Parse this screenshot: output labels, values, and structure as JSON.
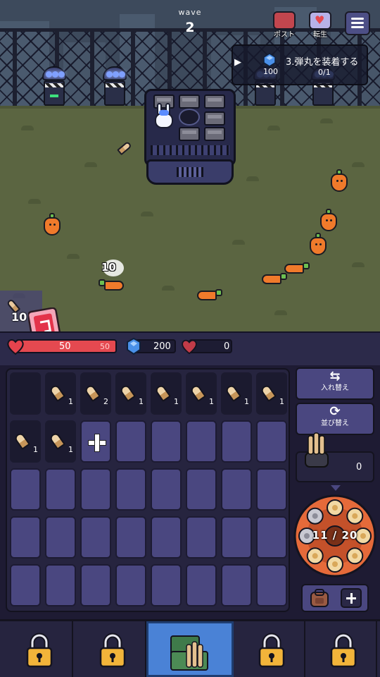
{
  "wave": {
    "label": "wave",
    "number": "2"
  },
  "top_buttons": [
    {
      "label": "ポスト",
      "icon": "mailbox-icon"
    },
    {
      "label": "転生",
      "icon": "rebirth-heart-icon"
    }
  ],
  "menu": {
    "icon": "hamburger-menu-icon"
  },
  "quest": {
    "text": "3.弾丸を装着する",
    "reward": "100",
    "progress": "0/1"
  },
  "battle": {
    "damage_popup": "10",
    "ammo_counter": "10"
  },
  "status": {
    "hp_current": "50",
    "hp_max": "50",
    "gems": "200",
    "bonus_hearts": "0",
    "colors": {
      "hp": "#e54950",
      "gem": "#4a90e8"
    }
  },
  "inventory": {
    "rows": [
      [
        {
          "type": "empty-dark"
        },
        {
          "type": "bullet",
          "count": "1"
        },
        {
          "type": "bullet",
          "count": "2"
        },
        {
          "type": "bullet",
          "count": "1"
        },
        {
          "type": "bullet",
          "count": "1"
        },
        {
          "type": "bullet",
          "count": "1"
        },
        {
          "type": "bullet",
          "count": "1"
        },
        {
          "type": "bullet",
          "count": "1"
        }
      ],
      [
        {
          "type": "bullet",
          "count": "1"
        },
        {
          "type": "bullet",
          "count": "1"
        },
        {
          "type": "add"
        },
        {
          "type": "empty"
        },
        {
          "type": "empty"
        },
        {
          "type": "empty"
        },
        {
          "type": "empty"
        },
        {
          "type": "empty"
        }
      ],
      [
        {
          "type": "empty"
        },
        {
          "type": "empty"
        },
        {
          "type": "empty"
        },
        {
          "type": "empty"
        },
        {
          "type": "empty"
        },
        {
          "type": "empty"
        },
        {
          "type": "empty"
        },
        {
          "type": "empty"
        }
      ],
      [
        {
          "type": "empty"
        },
        {
          "type": "empty"
        },
        {
          "type": "empty"
        },
        {
          "type": "empty"
        },
        {
          "type": "empty"
        },
        {
          "type": "empty"
        },
        {
          "type": "empty"
        },
        {
          "type": "empty"
        }
      ],
      [
        {
          "type": "empty"
        },
        {
          "type": "empty"
        },
        {
          "type": "empty"
        },
        {
          "type": "empty"
        },
        {
          "type": "empty"
        },
        {
          "type": "empty"
        },
        {
          "type": "empty"
        },
        {
          "type": "empty"
        }
      ]
    ]
  },
  "side": {
    "swap_label": "入れ替え",
    "sort_label": "並び替え",
    "loader_count": "0",
    "cylinder_text": "11 / 20"
  },
  "nav": {
    "tabs": [
      {
        "icon": "lock-icon",
        "locked": true
      },
      {
        "icon": "lock-icon",
        "locked": true
      },
      {
        "icon": "ammo-crate-icon",
        "active": true
      },
      {
        "icon": "lock-icon",
        "locked": true
      },
      {
        "icon": "lock-icon",
        "locked": true
      }
    ]
  }
}
